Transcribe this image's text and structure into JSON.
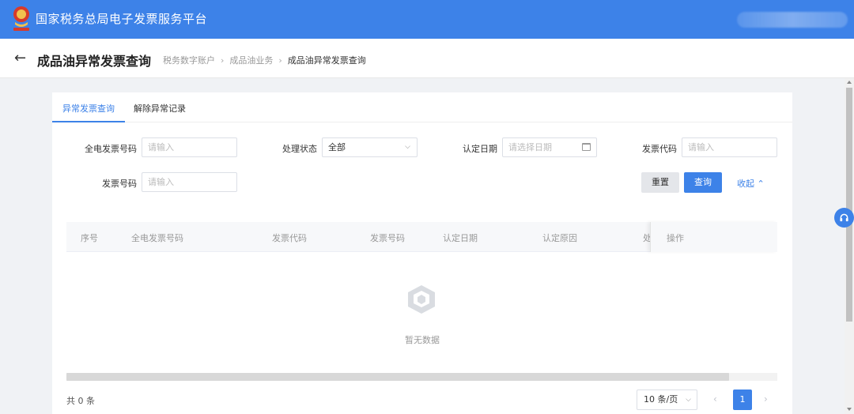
{
  "app": {
    "title": "国家税务总局电子发票服务平台"
  },
  "header": {
    "back_icon": "←",
    "title": "成品油异常发票查询",
    "breadcrumb": [
      "税务数字账户",
      "成品油业务",
      "成品油异常发票查询"
    ],
    "breadcrumb_separator": "›"
  },
  "tabs": [
    {
      "label": "异常发票查询",
      "active": true
    },
    {
      "label": "解除异常记录",
      "active": false
    }
  ],
  "form": {
    "einvoice_no": {
      "label": "全电发票号码",
      "placeholder": "请输入"
    },
    "status": {
      "label": "处理状态",
      "value": "全部"
    },
    "cert_date": {
      "label": "认定日期",
      "placeholder": "请选择日期"
    },
    "invoice_code": {
      "label": "发票代码",
      "placeholder": "请输入"
    },
    "invoice_no": {
      "label": "发票号码",
      "placeholder": "请输入"
    },
    "reset_label": "重置",
    "query_label": "查询",
    "collapse_label": "收起 ⌃"
  },
  "table": {
    "columns": [
      "序号",
      "全电发票号码",
      "发票代码",
      "发票号码",
      "认定日期",
      "认定原因",
      "处",
      "操作"
    ],
    "rows": [],
    "empty_text": "暂无数据"
  },
  "pagination": {
    "total_text": "共 0 条",
    "page_size": "10 条/页",
    "current_page": "1",
    "prev": "‹",
    "next": "›"
  },
  "icons": {
    "emblem": "emblem-icon",
    "empty": "empty-box-icon",
    "support": "headset-icon",
    "calendar": "calendar-icon"
  },
  "colors": {
    "primary": "#3d82e8",
    "topbar": "#3d82e8"
  }
}
